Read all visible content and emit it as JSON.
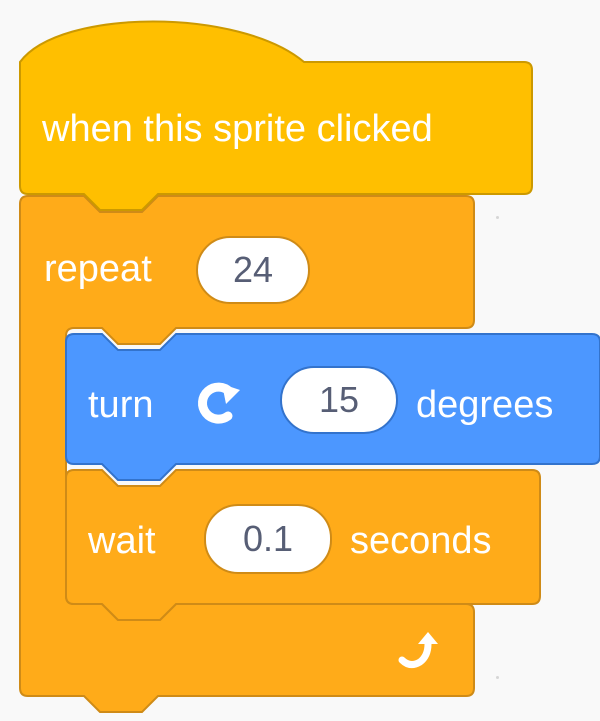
{
  "script": {
    "hat_block": {
      "label": "when this sprite clicked"
    },
    "repeat_block": {
      "label": "repeat",
      "count": "24",
      "loop_icon": "loop-arrow-icon"
    },
    "turn_block": {
      "label": "turn",
      "direction_icon": "rotate-clockwise-icon",
      "degrees_value": "15",
      "unit_label": "degrees"
    },
    "wait_block": {
      "label": "wait",
      "seconds_value": "0.1",
      "unit_label": "seconds"
    }
  },
  "colors": {
    "events": "#ffbf00",
    "events_border": "#cc9900",
    "control": "#ffab19",
    "control_border": "#cf8b17",
    "motion": "#4c97ff",
    "motion_border": "#3373cc",
    "input_text": "#575e75"
  }
}
